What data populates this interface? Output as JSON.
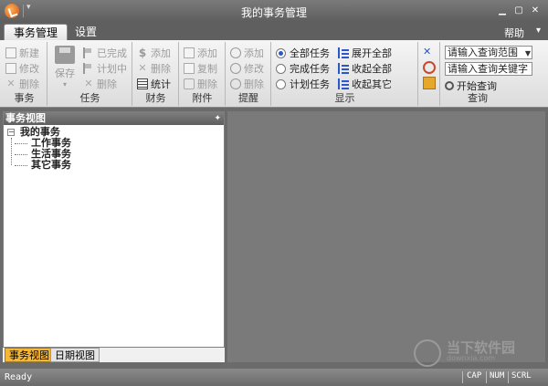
{
  "window": {
    "title": "我的事务管理",
    "controls": {
      "minimize": "▁",
      "maximize": "▢",
      "close": "✕"
    },
    "quick_access_arrow": "▾"
  },
  "tabs": [
    {
      "label": "事务管理",
      "active": true
    },
    {
      "label": "设置",
      "active": false
    }
  ],
  "help": {
    "label": "帮助",
    "arrow": "▾"
  },
  "ribbon": {
    "groups": {
      "affair": {
        "label": "事务",
        "buttons": [
          "新建",
          "修改",
          "删除"
        ]
      },
      "task": {
        "label": "任务",
        "save": "保存",
        "buttons": [
          "已完成",
          "计划中",
          "删除"
        ]
      },
      "finance": {
        "label": "财务",
        "buttons": [
          "添加",
          "删除",
          "统计"
        ]
      },
      "attachment": {
        "label": "附件",
        "buttons": [
          "添加",
          "复制",
          "删除"
        ]
      },
      "reminder": {
        "label": "提醒",
        "buttons": [
          "添加",
          "修改",
          "删除"
        ]
      },
      "display": {
        "label": "显示",
        "radios": [
          {
            "label": "全部任务",
            "checked": true
          },
          {
            "label": "完成任务",
            "checked": false
          },
          {
            "label": "计划任务",
            "checked": false
          }
        ],
        "tree_buttons": [
          "展开全部",
          "收起全部",
          "收起其它"
        ]
      },
      "query": {
        "label": "查询",
        "range_placeholder": "请输入查询范围",
        "keyword_placeholder": "请输入查询关键字",
        "start_button": "开始查询"
      }
    }
  },
  "panel": {
    "title": "事务视图",
    "pin": "✦",
    "tree": {
      "root": "我的事务",
      "expander": "−",
      "children": [
        "工作事务",
        "生活事务",
        "其它事务"
      ]
    },
    "bottom_tabs": [
      {
        "label": "事务视图",
        "active": true
      },
      {
        "label": "日期视图",
        "active": false
      }
    ]
  },
  "watermark": {
    "text": "当下软件园",
    "sub": "downxia.com"
  },
  "status": {
    "text": "Ready",
    "indicators": [
      "CAP",
      "NUM",
      "SCRL"
    ]
  },
  "colors": {
    "accent_active_tab": "#f7b733",
    "radio_blue": "#2a58c8",
    "chrome_dark": "#5f5f5f"
  }
}
